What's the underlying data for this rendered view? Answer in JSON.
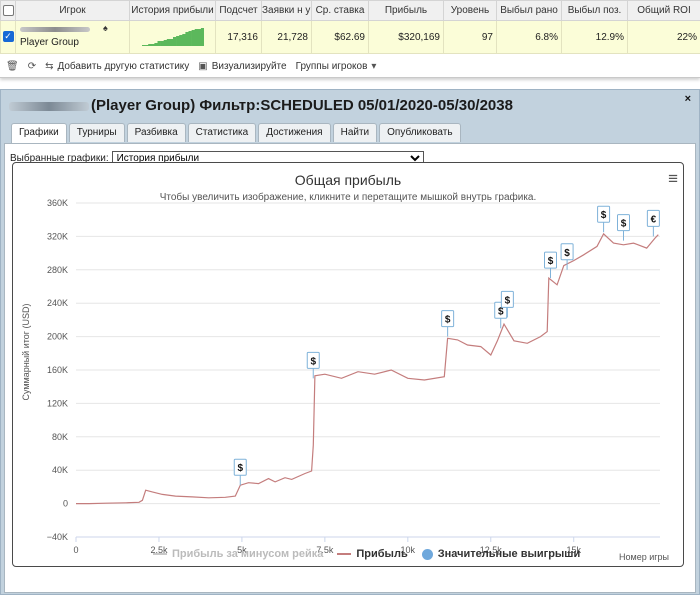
{
  "table": {
    "headers": [
      "Игрок",
      "История прибыли",
      "Подсчет",
      "Заявки н у·",
      "Ср. ставка",
      "Прибыль",
      "Уровень",
      "Выбыл рано",
      "Выбыл поз.",
      "Общий ROI"
    ],
    "row": {
      "player": "Player Group",
      "count": "17,316",
      "entries": "21,728",
      "avg_stake": "$62.69",
      "profit": "$320,169",
      "level": "97",
      "early_out": "6.8%",
      "late_out": "12.9%",
      "roi": "22%"
    }
  },
  "toolbar": {
    "add_stats": "Добавить другую статистику",
    "visualize": "Визуализируйте",
    "groups": "Группы игроков"
  },
  "panel": {
    "title": "(Player Group) Фильтр:SCHEDULED 05/01/2020-05/30/2038",
    "close": "×",
    "tabs": [
      "Графики",
      "Турниры",
      "Разбивка",
      "Статистика",
      "Достижения",
      "Найти",
      "Опубликовать"
    ],
    "selected_label": "Выбранные графики:",
    "selected_value": "История прибыли"
  },
  "chart_data": {
    "type": "line",
    "title": "Общая прибыль",
    "subtitle": "Чтобы увеличить изображение, кликните и перетащите мышкой внутрь графика.",
    "xlabel": "Номер игры",
    "ylabel": "Суммарный итог (USD)",
    "xlim": [
      0,
      17600
    ],
    "ylim": [
      -40000,
      360000
    ],
    "x_ticks": [
      {
        "v": 0,
        "l": "0"
      },
      {
        "v": 2500,
        "l": "2.5k"
      },
      {
        "v": 5000,
        "l": "5k"
      },
      {
        "v": 7500,
        "l": "7.5k"
      },
      {
        "v": 10000,
        "l": "10k"
      },
      {
        "v": 12500,
        "l": "12.5k"
      },
      {
        "v": 15000,
        "l": "15k"
      }
    ],
    "y_ticks": [
      {
        "v": -40000,
        "l": "−40K"
      },
      {
        "v": 0,
        "l": "0"
      },
      {
        "v": 40000,
        "l": "40K"
      },
      {
        "v": 80000,
        "l": "80K"
      },
      {
        "v": 120000,
        "l": "120K"
      },
      {
        "v": 160000,
        "l": "160K"
      },
      {
        "v": 200000,
        "l": "200K"
      },
      {
        "v": 240000,
        "l": "240K"
      },
      {
        "v": 280000,
        "l": "280K"
      },
      {
        "v": 320000,
        "l": "320K"
      },
      {
        "v": 360000,
        "l": "360K"
      }
    ],
    "series": [
      {
        "name": "Прибыль за минусом рейка",
        "color": "#c8c8c8",
        "visible": false,
        "points": []
      },
      {
        "name": "Прибыль",
        "color": "#c47d7d",
        "visible": true,
        "points": [
          [
            0,
            0
          ],
          [
            400,
            0
          ],
          [
            900,
            500
          ],
          [
            1500,
            1000
          ],
          [
            1900,
            1500
          ],
          [
            2000,
            4000
          ],
          [
            2100,
            16000
          ],
          [
            2300,
            14000
          ],
          [
            2600,
            11000
          ],
          [
            3000,
            9000
          ],
          [
            3500,
            8000
          ],
          [
            4000,
            7000
          ],
          [
            4500,
            7500
          ],
          [
            4800,
            9000
          ],
          [
            4950,
            22000
          ],
          [
            5200,
            25000
          ],
          [
            5500,
            24000
          ],
          [
            5800,
            30000
          ],
          [
            6000,
            26000
          ],
          [
            6300,
            31000
          ],
          [
            6500,
            29000
          ],
          [
            6900,
            36000
          ],
          [
            7100,
            39000
          ],
          [
            7150,
            70000
          ],
          [
            7200,
            153000
          ],
          [
            7500,
            155000
          ],
          [
            8000,
            150000
          ],
          [
            8500,
            158000
          ],
          [
            9000,
            155000
          ],
          [
            9500,
            160000
          ],
          [
            10000,
            150000
          ],
          [
            10500,
            148000
          ],
          [
            11100,
            152000
          ],
          [
            11200,
            198000
          ],
          [
            11500,
            196000
          ],
          [
            11800,
            190000
          ],
          [
            12200,
            188000
          ],
          [
            12500,
            178000
          ],
          [
            12700,
            195000
          ],
          [
            12900,
            215000
          ],
          [
            13200,
            195000
          ],
          [
            13600,
            192000
          ],
          [
            14000,
            200000
          ],
          [
            14200,
            206000
          ],
          [
            14250,
            270000
          ],
          [
            14500,
            262000
          ],
          [
            14700,
            285000
          ],
          [
            15000,
            291000
          ],
          [
            15300,
            298000
          ],
          [
            15700,
            308000
          ],
          [
            15900,
            323000
          ],
          [
            16200,
            312000
          ],
          [
            16500,
            310000
          ],
          [
            16800,
            312000
          ],
          [
            17200,
            306000
          ],
          [
            17450,
            318000
          ],
          [
            17550,
            322000
          ]
        ]
      },
      {
        "name": "Значительные выигрыши",
        "color": "#6fa8dc",
        "visible": true,
        "points": []
      }
    ],
    "markers": [
      {
        "x": 4950,
        "y": 22000,
        "label": "$"
      },
      {
        "x": 7150,
        "y": 150000,
        "label": "$"
      },
      {
        "x": 11200,
        "y": 200000,
        "label": "$"
      },
      {
        "x": 12800,
        "y": 210000,
        "label": "$"
      },
      {
        "x": 13000,
        "y": 223000,
        "label": "$"
      },
      {
        "x": 14300,
        "y": 270000,
        "label": "$"
      },
      {
        "x": 14800,
        "y": 280000,
        "label": "$"
      },
      {
        "x": 15900,
        "y": 325000,
        "label": "$"
      },
      {
        "x": 16500,
        "y": 315000,
        "label": "$"
      },
      {
        "x": 17400,
        "y": 320000,
        "label": "€"
      }
    ],
    "grid_y": true,
    "legend_position": "bottom"
  },
  "sparkline": {
    "color": "#5cb85c",
    "values": [
      1,
      1,
      2,
      2,
      3,
      5,
      5,
      6,
      7,
      7,
      9,
      10,
      11,
      12,
      14,
      15,
      16,
      17,
      17,
      18
    ]
  }
}
